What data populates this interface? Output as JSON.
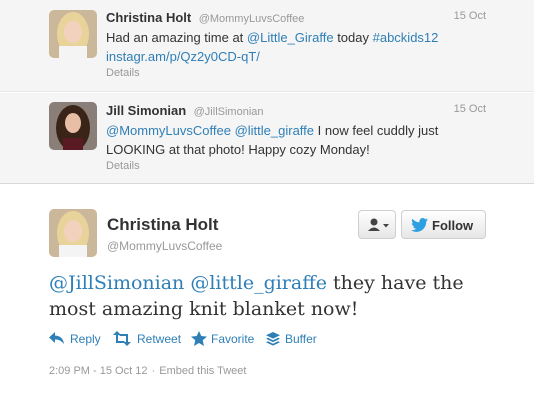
{
  "replies": [
    {
      "fullname": "Christina Holt",
      "screenname": "@MommyLuvsCoffee",
      "date": "15 Oct",
      "text_parts": [
        "Had an amazing time at ",
        "@Little_Giraffe",
        " today ",
        "#abckids12",
        "instagr.am/p/Qz2y0CD-qT/"
      ],
      "details": "Details"
    },
    {
      "fullname": "Jill Simonian",
      "screenname": "@JillSimonian",
      "date": "15 Oct",
      "text_parts": [
        "@MommyLuvsCoffee",
        " ",
        "@little_giraffe",
        " I now feel cuddly just LOOKING at that photo! Happy cozy Monday!"
      ],
      "details": "Details"
    }
  ],
  "main_tweet": {
    "fullname": "Christina Holt",
    "screenname": "@MommyLuvsCoffee",
    "follow_label": "Follow",
    "text_parts": [
      "@JillSimonian",
      " ",
      "@little_giraffe",
      " they have the most amazing knit blanket now!"
    ],
    "actions": {
      "reply": "Reply",
      "retweet": "Retweet",
      "favorite": "Favorite",
      "buffer": "Buffer"
    },
    "timestamp": "2:09 PM - 15 Oct 12",
    "separator": "·",
    "embed": "Embed this Tweet"
  },
  "icons": {
    "user_menu": "user-dropdown-icon",
    "follow": "twitter-bird-icon",
    "reply": "reply-arrow-icon",
    "retweet": "retweet-icon",
    "favorite": "star-icon",
    "buffer": "buffer-stack-icon"
  },
  "colors": {
    "link": "#2f7fb7",
    "twitter_blue": "#2e9fe1",
    "muted": "#999999",
    "reply_bg": "#f5f5f5"
  }
}
